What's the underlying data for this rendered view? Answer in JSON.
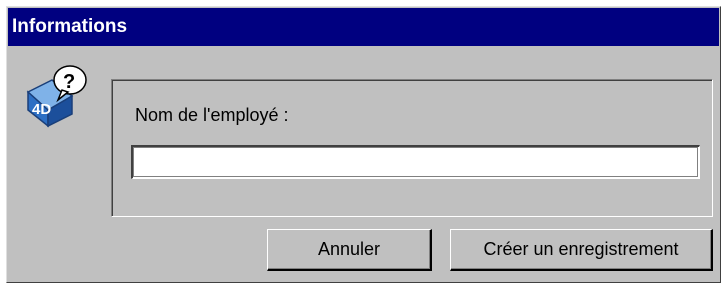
{
  "window": {
    "title": "Informations"
  },
  "icon": {
    "name": "4d-help-icon"
  },
  "form": {
    "employee_name_label": "Nom de l'employé :",
    "employee_name_value": "",
    "employee_name_placeholder": ""
  },
  "buttons": {
    "cancel_label": "Annuler",
    "create_label": "Créer un enregistrement"
  },
  "colors": {
    "titlebar": "#000080",
    "face": "#c0c0c0"
  }
}
